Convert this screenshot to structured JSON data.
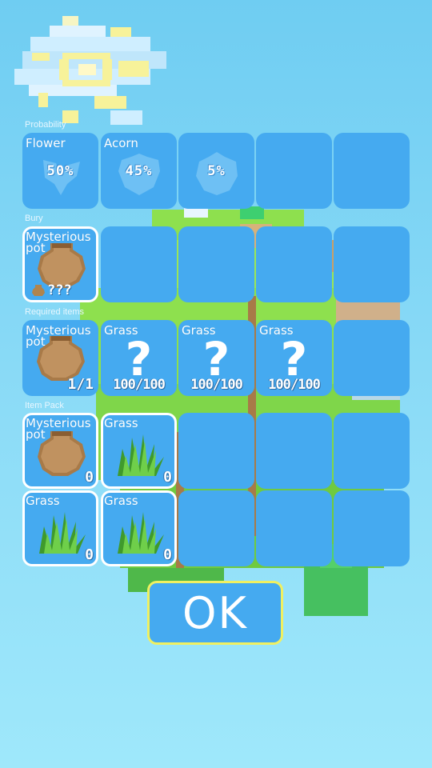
{
  "sections": {
    "probability": "Probability",
    "bury": "Bury",
    "required": "Required items",
    "pack": "Item Pack"
  },
  "probability": [
    {
      "name": "Flower",
      "value": "50%",
      "icon": "flower-silhouette-icon"
    },
    {
      "name": "Acorn",
      "value": "45%",
      "icon": "acorn-silhouette-icon"
    },
    {
      "name": "",
      "value": "5%",
      "icon": "gem-silhouette-icon"
    }
  ],
  "bury": {
    "name": "Mysterious pot",
    "result": "???",
    "icon": "clay-pot-icon"
  },
  "required": [
    {
      "name": "Mysterious pot",
      "count": "1/1",
      "icon": "clay-pot-icon"
    },
    {
      "name": "Grass",
      "count": "100/100",
      "icon": "question-mark-icon",
      "glyph": "?"
    },
    {
      "name": "Grass",
      "count": "100/100",
      "icon": "question-mark-icon",
      "glyph": "?"
    },
    {
      "name": "Grass",
      "count": "100/100",
      "icon": "question-mark-icon",
      "glyph": "?"
    }
  ],
  "pack": [
    {
      "name": "Mysterious pot",
      "count": "0",
      "icon": "clay-pot-icon"
    },
    {
      "name": "Grass",
      "count": "0",
      "icon": "grass-tuft-icon"
    },
    {
      "name": "Grass",
      "count": "0",
      "icon": "grass-tuft-icon"
    },
    {
      "name": "Grass",
      "count": "0",
      "icon": "grass-tuft-icon"
    }
  ],
  "ok_label": "OK",
  "colors": {
    "slot": "#45aaf0",
    "selected_border": "#ffffff",
    "ok_border": "#f0f060",
    "sky": "#6fcdf2"
  }
}
